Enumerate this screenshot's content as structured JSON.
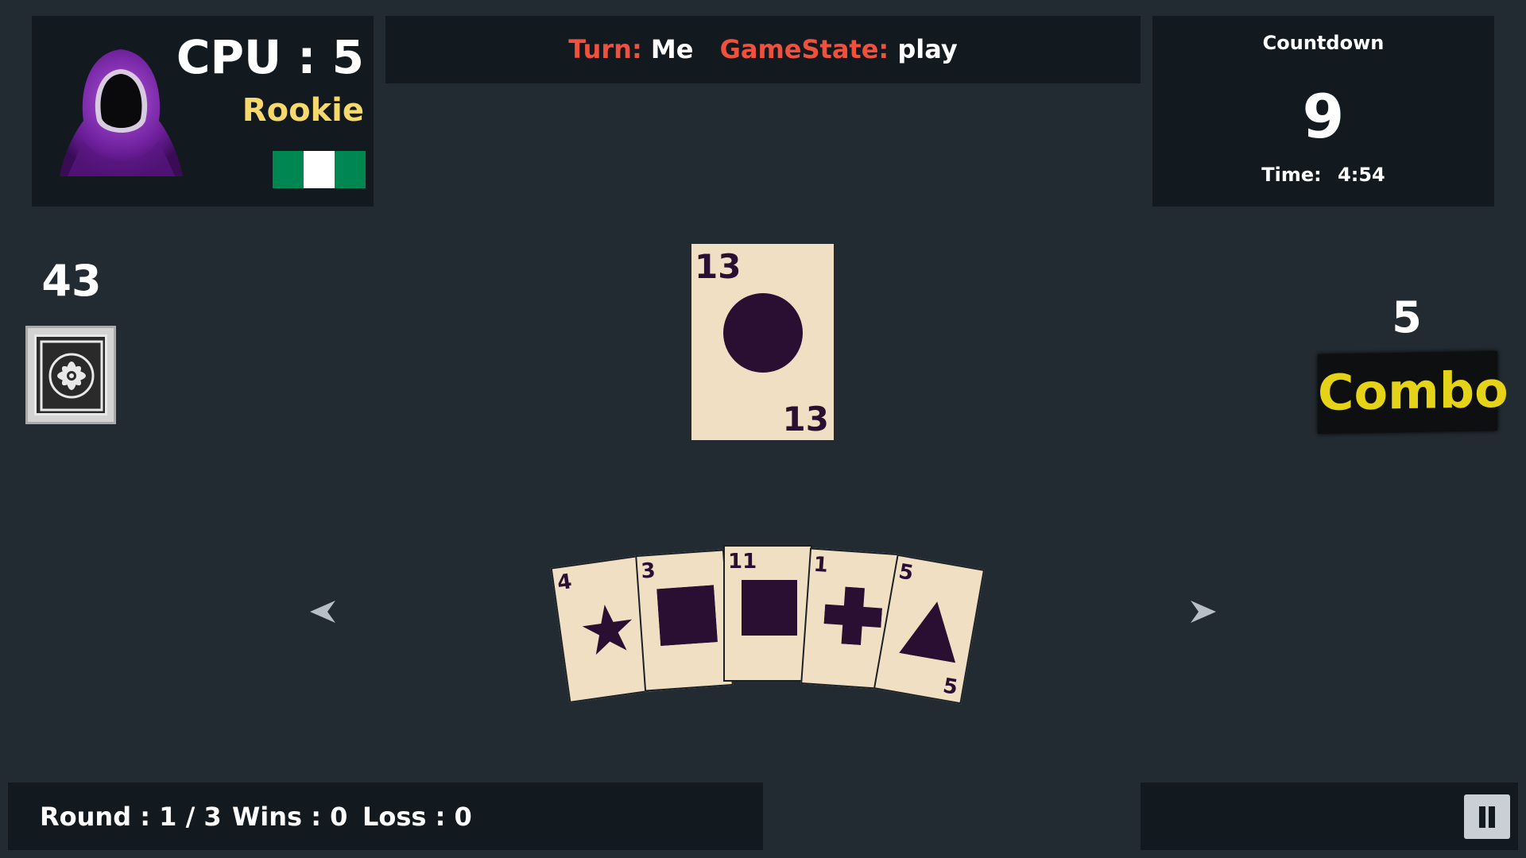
{
  "opponent": {
    "name_score": "CPU : 5",
    "rank": "Rookie",
    "flag_colors": [
      "#008751",
      "#ffffff",
      "#008751"
    ],
    "avatar_icon": "hooded-figure"
  },
  "status": {
    "turn_label": "Turn:",
    "turn_value": "Me",
    "state_label": "GameState:",
    "state_value": "play"
  },
  "countdown": {
    "label": "Countdown",
    "value": "9",
    "time_label": "Time:",
    "time_value": "4:54"
  },
  "deck": {
    "count": "43",
    "icon": "ornament-card-back"
  },
  "pile": {
    "number": "13",
    "shape": "circle"
  },
  "hand": [
    {
      "number": "4",
      "shape": "star"
    },
    {
      "number": "3",
      "shape": "square"
    },
    {
      "number": "11",
      "shape": "square"
    },
    {
      "number": "1",
      "shape": "cross"
    },
    {
      "number": "5",
      "shape": "triangle"
    }
  ],
  "combo": {
    "count": "5",
    "label": "Combo"
  },
  "round_info": {
    "round": "Round : 1 / 3",
    "wins": "Wins : 0",
    "loss": "Loss : 0"
  },
  "colors": {
    "background": "#222b32",
    "panel": "#131a1f",
    "card": "#f1dfc4",
    "card_ink": "#2a0f33",
    "accent_red": "#f1503d",
    "rank_yellow": "#f6d96d",
    "combo_yellow": "#e4d317"
  }
}
